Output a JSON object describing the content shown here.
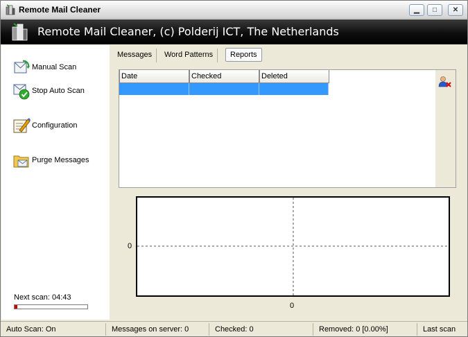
{
  "window": {
    "title": "Remote Mail Cleaner",
    "minimize_glyph": "▁",
    "maximize_glyph": "□",
    "close_glyph": "✕"
  },
  "banner": {
    "title": "Remote Mail Cleaner, (c) Polderij ICT, The Netherlands"
  },
  "sidebar": {
    "items": [
      {
        "label": "Manual Scan",
        "icon": "manual-scan-icon"
      },
      {
        "label": "Stop Auto Scan",
        "icon": "stop-auto-scan-icon"
      },
      {
        "label": "Configuration",
        "icon": "configuration-icon"
      },
      {
        "label": "Purge Messages",
        "icon": "purge-messages-icon"
      }
    ],
    "next_scan": "Next scan: 04:43",
    "next_scan_progress": 0.04,
    "progress_color": "#cc0000"
  },
  "tabs": [
    {
      "label": "Messages",
      "active": false
    },
    {
      "label": "Word Patterns",
      "active": false
    },
    {
      "label": "Reports",
      "active": true
    }
  ],
  "table": {
    "columns": [
      "Date",
      "Checked",
      "Deleted"
    ],
    "rows": [],
    "selected_row_color": "#3399ff"
  },
  "graph": {
    "y_label": "0",
    "x_label": "0"
  },
  "statusbar": {
    "auto_scan": "Auto Scan: On",
    "messages_on_server": "Messages on server: 0",
    "checked": "Checked: 0",
    "removed": "Removed: 0  [0.00%]",
    "last_scan": "Last scan"
  }
}
